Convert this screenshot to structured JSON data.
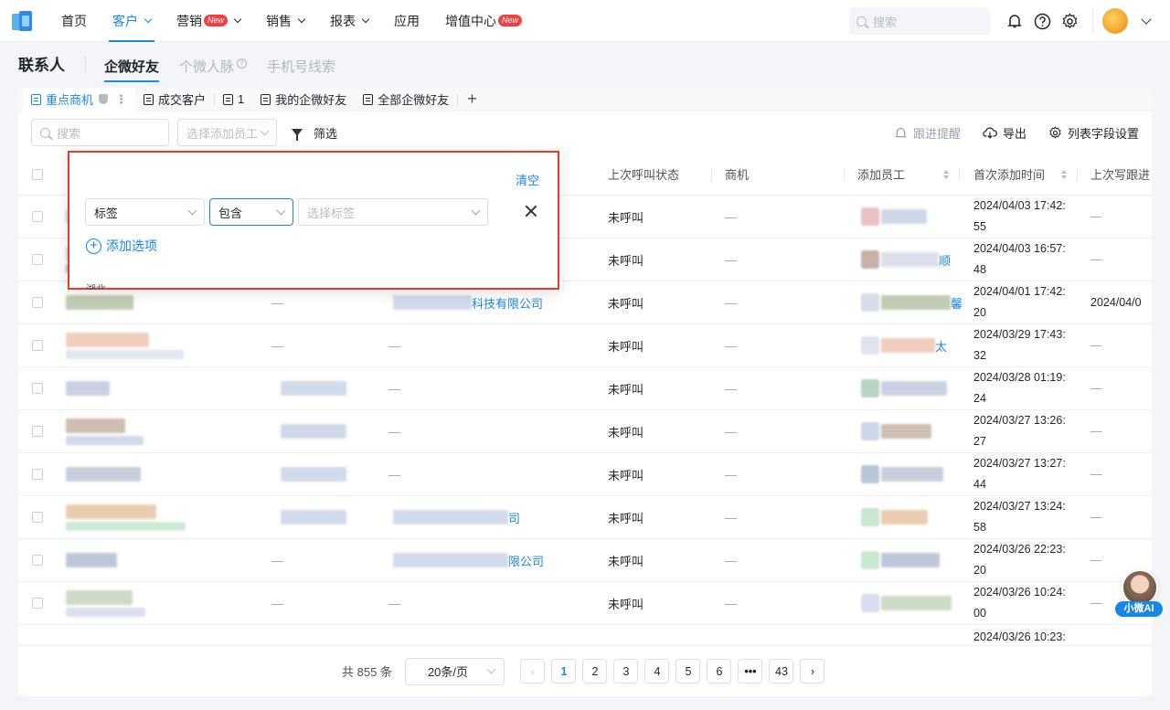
{
  "nav": {
    "items": [
      {
        "label": "首页"
      },
      {
        "label": "客户"
      },
      {
        "label": "营销",
        "badge": "New"
      },
      {
        "label": "销售"
      },
      {
        "label": "报表"
      },
      {
        "label": "应用"
      },
      {
        "label": "增值中心",
        "badge": "New"
      }
    ],
    "search_placeholder": "搜索",
    "icons": [
      "bell-icon",
      "help-icon",
      "settings-icon"
    ]
  },
  "page": {
    "title": "联系人",
    "tabs": [
      "企微好友",
      "个微人脉",
      "手机号线索"
    ]
  },
  "view_tabs": [
    "重点商机",
    "成交客户",
    "1",
    "我的企微好友",
    "全部企微好友"
  ],
  "toolbar": {
    "search_placeholder": "搜索",
    "employee_placeholder": "选择添加员工",
    "filter_label": "筛选",
    "reminder_label": "跟进提醒",
    "export_label": "导出",
    "columns_label": "列表字段设置"
  },
  "filter_popup": {
    "clear_label": "清空",
    "field": "标签",
    "operator": "包含",
    "value_placeholder": "选择标签",
    "add_label": "添加选项",
    "peek_text": "湖北"
  },
  "table": {
    "headers": {
      "call_status": "上次呼叫状态",
      "opportunity": "商机",
      "employee": "添加员工",
      "first_added": "首次添加时间",
      "last_followup": "上次写跟进"
    },
    "rows": [
      {
        "company": "",
        "call": "未呼叫",
        "opp": "—",
        "emp": "",
        "time1": "2024/04/03 17:42:",
        "time2": "55",
        "follow": "—"
      },
      {
        "company": "",
        "call": "未呼叫",
        "opp": "—",
        "emp": "顺",
        "time1": "2024/04/03 16:57:",
        "time2": "48",
        "follow": "—"
      },
      {
        "c2": "—",
        "company": "科技有限公司",
        "call": "未呼叫",
        "opp": "—",
        "emp": "馨",
        "time1": "2024/04/01 17:42:",
        "time2": "20",
        "follow": "2024/04/0"
      },
      {
        "c2": "—",
        "company": "—",
        "call": "未呼叫",
        "opp": "—",
        "emp": "太",
        "time1": "2024/03/29 17:43:",
        "time2": "32",
        "follow": "—"
      },
      {
        "c2": "",
        "company": "—",
        "call": "未呼叫",
        "opp": "—",
        "emp": "",
        "time1": "2024/03/28 01:19:",
        "time2": "24",
        "follow": "—"
      },
      {
        "c2": "",
        "company": "—",
        "call": "未呼叫",
        "opp": "—",
        "emp": "",
        "time1": "2024/03/27 13:26:",
        "time2": "27",
        "follow": "—"
      },
      {
        "c2": "",
        "company": "—",
        "call": "未呼叫",
        "opp": "—",
        "emp": "",
        "time1": "2024/03/27 13:27:",
        "time2": "44",
        "follow": "—"
      },
      {
        "c2": "",
        "company": "司",
        "call": "未呼叫",
        "opp": "—",
        "emp": "",
        "time1": "2024/03/27 13:24:",
        "time2": "58",
        "follow": "—"
      },
      {
        "c2": "—",
        "company": "限公司",
        "call": "未呼叫",
        "opp": "—",
        "emp": "",
        "time1": "2024/03/26 22:23:",
        "time2": "20",
        "follow": "—"
      },
      {
        "c2": "—",
        "company": "—",
        "call": "未呼叫",
        "opp": "—",
        "emp": "",
        "time1": "2024/03/26 10:24:",
        "time2": "00",
        "follow": "—"
      }
    ],
    "partial_time": "2024/03/26 10:23:"
  },
  "pager": {
    "total": "共 855 条",
    "size": "20条/页",
    "pages": [
      "1",
      "2",
      "3",
      "4",
      "5",
      "6",
      "•••",
      "43"
    ]
  },
  "ai_widget": {
    "label": "小微AI"
  },
  "colors": {
    "accent": "#1a86e5",
    "badge": "#f0413e",
    "highlight": "#e43d30"
  }
}
